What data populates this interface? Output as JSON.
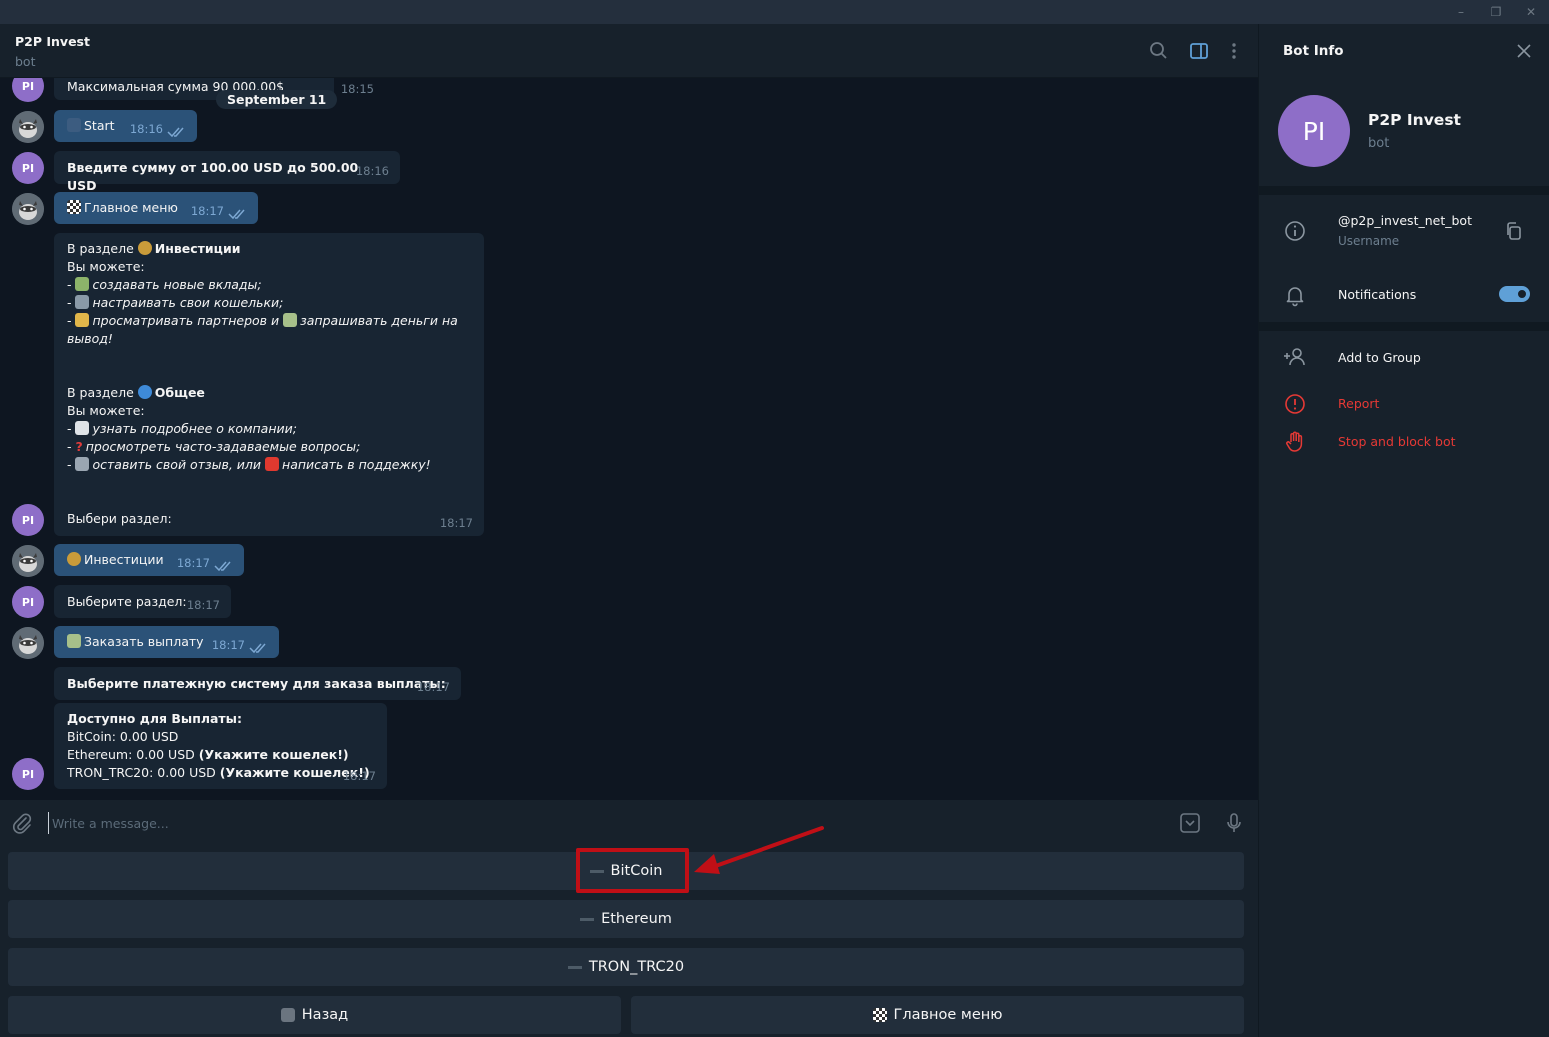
{
  "chat": {
    "title": "P2P Invest",
    "subtitle": "bot",
    "date_badge": "September 11",
    "avatar_initials": "PI",
    "messages": {
      "m0_text": "Максимальная сумма 90 000.00$",
      "m0_time": "18:15",
      "m1_text": "Start",
      "m1_time": "18:16",
      "m2_text": "Введите сумму от 100.00 USD до 500.00 USD",
      "m2_time": "18:16",
      "m3_text": "Главное меню",
      "m3_time": "18:17",
      "m4": {
        "l1_a": "В разделе ",
        "l1_b": "Инвестиции",
        "l2": "Вы можете:",
        "l3": "создавать новые вклады;",
        "l4": "настраивать свои кошельки;",
        "l5_a": "просматривать партнеров и ",
        "l5_b": "запрашивать деньги на вывод!",
        "l6_a": "В разделе ",
        "l6_b": "Общее",
        "l7": "Вы можете:",
        "l8": "узнать подробнее о компании;",
        "l9": "просмотреть часто-задаваемые вопросы;",
        "l10_a": "оставить свой отзыв, или ",
        "l10_b": "написать в поддежку!",
        "l11": "Выбери раздел:",
        "time": "18:17"
      },
      "m5_text": "Инвестиции",
      "m5_time": "18:17",
      "m6_text": "Выберите раздел:",
      "m6_time": "18:17",
      "m7_text": "Заказать выплату",
      "m7_time": "18:17",
      "m8_text": "Выберите платежную систему для заказа выплаты:",
      "m8_time": "18:17",
      "m9": {
        "l1": "Доступно для Выплаты:",
        "l2": "BitCoin: 0.00 USD",
        "l3_a": "Ethereum: 0.00 USD ",
        "l3_b": "(Укажите кошелек!)",
        "l4_a": "TRON_TRC20: 0.00 USD ",
        "l4_b": "(Укажите кошелек!)",
        "time": "18:17"
      }
    }
  },
  "composer": {
    "placeholder": "Write a message..."
  },
  "keyboard": {
    "btn_bitcoin": "BitCoin",
    "btn_ethereum": "Ethereum",
    "btn_tron": "TRON_TRC20",
    "btn_back": "Назад",
    "btn_main": "Главное меню"
  },
  "panel": {
    "title": "Bot Info",
    "name": "P2P Invest",
    "sub": "bot",
    "avatar_initials": "PI",
    "username": "@p2p_invest_net_bot",
    "username_label": "Username",
    "notifications": "Notifications",
    "notifications_on": true,
    "add_to_group": "Add to Group",
    "report": "Report",
    "stop_block": "Stop and block bot"
  },
  "colors": {
    "accent": "#5fa0d7",
    "outgoing_bubble": "#2b5278",
    "incoming_bubble": "#182533",
    "danger": "#e53935",
    "highlight_box": "#c00f16"
  }
}
